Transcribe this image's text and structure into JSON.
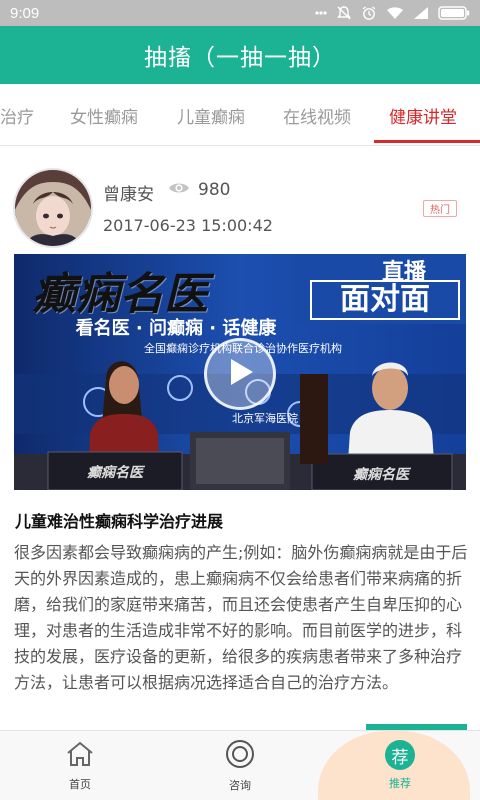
{
  "status_bar": {
    "time": "9:09",
    "icons": [
      "signal-dots-icon",
      "mute-icon",
      "alarm-icon",
      "wifi-icon",
      "cellular-icon",
      "battery-icon"
    ]
  },
  "header": {
    "title": "抽搐（一抽一抽）"
  },
  "tabs": [
    {
      "label": "治疗",
      "active": false
    },
    {
      "label": "女性癫痫",
      "active": false
    },
    {
      "label": "儿童癫痫",
      "active": false
    },
    {
      "label": "在线视频",
      "active": false
    },
    {
      "label": "健康讲堂",
      "active": true
    }
  ],
  "post": {
    "author": "曾康安",
    "views": "980",
    "date": "2017-06-23 15:00:42",
    "badge": "热门",
    "video": {
      "big_title": "癫痫名医",
      "sub_title": "看名医 · 问癫痫 · 话健康",
      "tag_top": "直播",
      "tag_bottom": "面对面",
      "org_line": "全国癫痫诊疗机构联合诊治协作医疗机构",
      "bottom_line": "北京军海医院",
      "desk_sign": "癫痫名医"
    },
    "headline": "儿童难治性癫痫科学治疗进展",
    "excerpt": "很多因素都会导致癫痫病的产生;例如：脑外伤癫痫病就是由于后天的外界因素造成的，患上癫痫病不仅会给患者们带来病痛的折磨，给我们的家庭带来痛苦，而且还会使患者产生自卑压抑的心理，对患者的生活造成非常不好的影响。而目前医学的进步，科技的发展，医疗设备的更新，给很多的疾病患者带来了多种治疗方法，让患者可以根据病况选择适合自己的治疗方法。"
  },
  "bottom_nav": [
    {
      "label": "首页",
      "icon": "home-icon",
      "active": false
    },
    {
      "label": "咨询",
      "icon": "consult-icon",
      "active": false
    },
    {
      "label": "推荐",
      "icon": "recommend-icon",
      "icon_text": "荐",
      "active": true
    }
  ],
  "colors": {
    "primary": "#1bb394",
    "active_tab": "#d9292b",
    "status_bar": "#bdbdbd",
    "nav_highlight": "#fde2cc"
  }
}
